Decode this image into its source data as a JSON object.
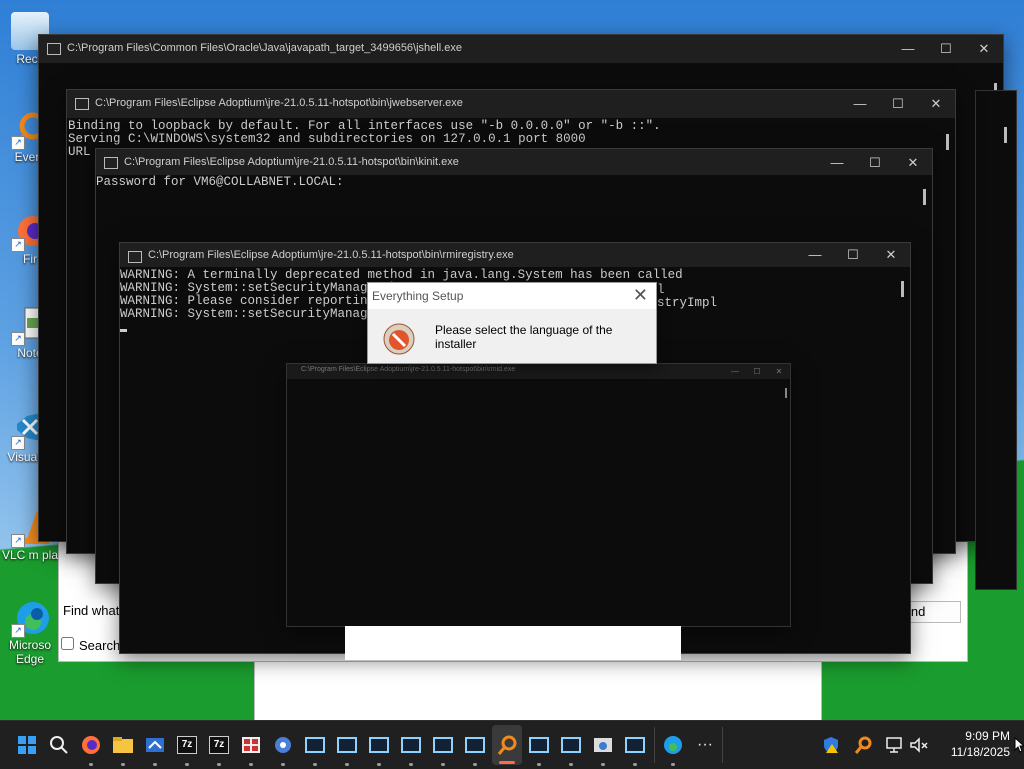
{
  "desktop": {
    "icons": [
      {
        "label": "Recy",
        "icon": "recycle-bin-icon"
      },
      {
        "label": "Every",
        "icon": "everything-search-icon"
      },
      {
        "label": "Fir",
        "icon": "firefox-icon"
      },
      {
        "label": "Note",
        "icon": "notepad-icon"
      },
      {
        "label": "Visual Q",
        "icon": "vscode-icon"
      },
      {
        "label": "VLC m pla",
        "icon": "vlc-icon"
      },
      {
        "label": "Microso Edge",
        "icon": "edge-icon"
      }
    ]
  },
  "windows": {
    "jshell": {
      "title": "C:\\Program Files\\Common Files\\Oracle\\Java\\javapath_target_3499656\\jshell.exe"
    },
    "jwebserver": {
      "title": "C:\\Program Files\\Eclipse Adoptium\\jre-21.0.5.11-hotspot\\bin\\jwebserver.exe",
      "lines": [
        "Binding to loopback by default. For all interfaces use \"-b 0.0.0.0\" or \"-b ::\".",
        "Serving C:\\WINDOWS\\system32 and subdirectories on 127.0.0.1 port 8000",
        "URL"
      ]
    },
    "kinit": {
      "title": "C:\\Program Files\\Eclipse Adoptium\\jre-21.0.5.11-hotspot\\bin\\kinit.exe",
      "lines": [
        "Password for VM6@COLLABNET.LOCAL:"
      ]
    },
    "rmiregistry": {
      "title": "C:\\Program Files\\Eclipse Adoptium\\jre-21.0.5.11-hotspot\\bin\\rmiregistry.exe",
      "lines": [
        "WARNING: A terminally deprecated method in java.lang.System has been called",
        "WARNING: System::setSecurityManager ha",
        "WARNING: Please consider reporting thi",
        "WARNING: System::setSecurityManager wi"
      ],
      "hidden_tails": [
        "l",
        "stryImpl"
      ]
    },
    "small_console": {
      "title": "C:\\Program Files\\Eclipse Adoptium\\jre-21.0.5.11-hotspot\\bin\\rmid.exe"
    },
    "find_dialog": {
      "find_what_label": "Find what:",
      "search_label": "Search",
      "find_button": "ind"
    }
  },
  "setup_dialog": {
    "title": "Everything Setup",
    "message": "Please select the language of the installer"
  },
  "taskbar": {
    "clock_time": "9:09 PM",
    "clock_date": "11/18/2025",
    "overflow": "···"
  }
}
